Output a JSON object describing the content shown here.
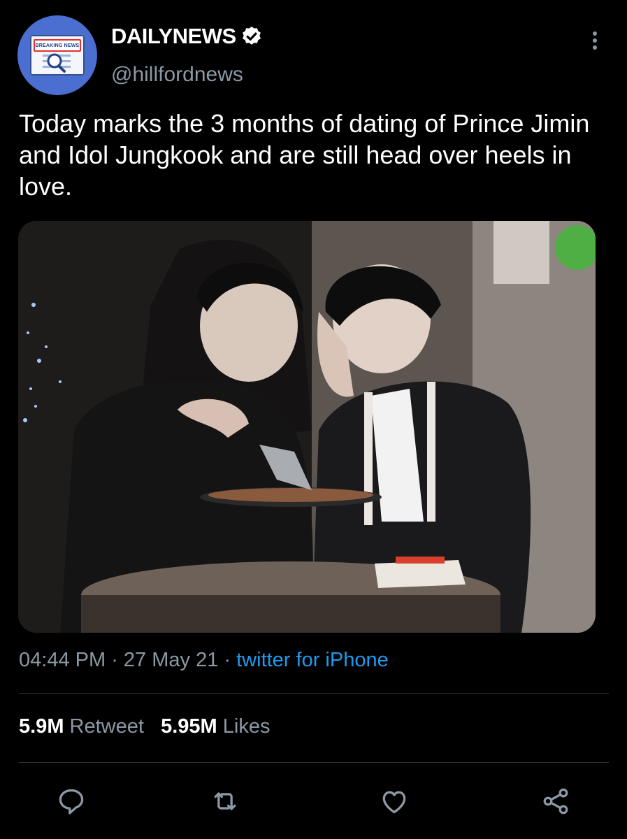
{
  "author": {
    "avatar_banner_text": "BREAKING NEWS",
    "display_name": "DAILYNEWS",
    "handle": "@hillfordnews",
    "verified_icon": "verified-badge-icon"
  },
  "tweet": {
    "text": "Today marks the 3 months of dating of Prince Jimin and Idol Jungkook and are still head over heels in love.",
    "media_alt": "photo of two people sharing pizza at a cafe table"
  },
  "meta": {
    "time": "04:44 PM",
    "separator": " · ",
    "date": "27 May 21",
    "separator2": " · ",
    "source": "twitter for iPhone"
  },
  "stats": {
    "retweets_count": "5.9M",
    "retweets_label": "Retweet",
    "likes_count": "5.95M",
    "likes_label": "Likes"
  },
  "actions": [
    "reply-icon",
    "retweet-icon",
    "like-icon",
    "share-icon"
  ],
  "colors": {
    "background": "#000000",
    "secondary_text": "#8b98a5",
    "link": "#1d9bf0",
    "avatar": "#4a6fd0"
  }
}
